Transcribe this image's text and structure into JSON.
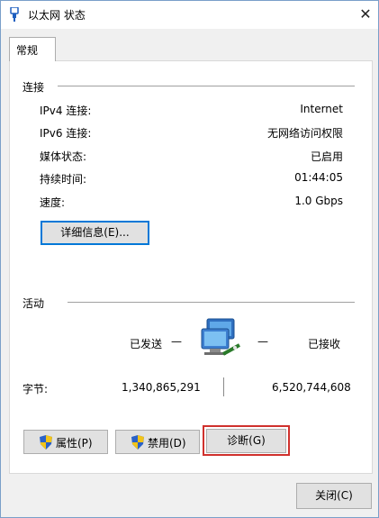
{
  "window": {
    "title": "以太网 状态",
    "close_glyph": "✕",
    "icon": "ethernet-plug-icon"
  },
  "tabs": [
    {
      "label": "常规",
      "selected": true
    }
  ],
  "connection": {
    "heading": "连接",
    "rows": [
      {
        "label": "IPv4 连接:",
        "value": "Internet"
      },
      {
        "label": "IPv6 连接:",
        "value": "无网络访问权限"
      },
      {
        "label": "媒体状态:",
        "value": "已启用"
      },
      {
        "label": "持续时间:",
        "value": "01:44:05"
      },
      {
        "label": "速度:",
        "value": "1.0 Gbps"
      }
    ],
    "details_button": "详细信息(E)..."
  },
  "activity": {
    "heading": "活动",
    "sent_label": "已发送",
    "received_label": "已接收",
    "dash": "—",
    "bytes_label": "字节:",
    "bytes_sent": "1,340,865,291",
    "bytes_received": "6,520,744,608",
    "network_icon": "network-computers-icon"
  },
  "buttons": {
    "properties": "属性(P)",
    "disable": "禁用(D)",
    "diagnose": "诊断(G)",
    "close": "关闭(C)"
  },
  "colors": {
    "accent": "#0078d7",
    "highlight_box": "#d0312d",
    "shield_blue": "#2b62c8",
    "shield_yellow": "#f2c419"
  }
}
